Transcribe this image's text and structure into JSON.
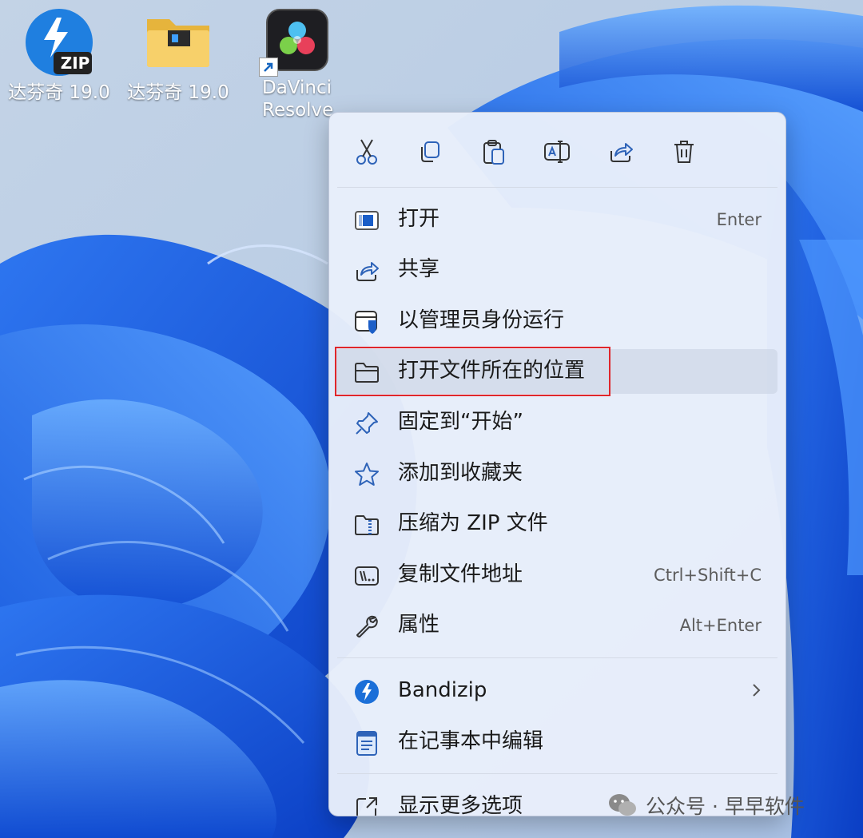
{
  "desktop": {
    "icons": [
      {
        "name": "bandizip-zip",
        "label": "达芬奇 19.0",
        "badge": "ZIP"
      },
      {
        "name": "folder",
        "label": "达芬奇 19.0"
      },
      {
        "name": "davinci-resolve",
        "label": "DaVinci\nResolve"
      }
    ]
  },
  "menu": {
    "toolbar": [
      "cut",
      "copy",
      "paste",
      "rename",
      "share",
      "delete"
    ],
    "items": [
      {
        "label": "打开",
        "shortcut": "Enter",
        "icon": "open-icon"
      },
      {
        "label": "共享",
        "shortcut": "",
        "icon": "share-icon"
      },
      {
        "label": "以管理员身份运行",
        "shortcut": "",
        "icon": "run-as-admin-icon"
      },
      {
        "label": "打开文件所在的位置",
        "shortcut": "",
        "icon": "folder-open-icon"
      },
      {
        "label": "固定到“开始”",
        "shortcut": "",
        "icon": "pin-icon"
      },
      {
        "label": "添加到收藏夹",
        "shortcut": "",
        "icon": "star-icon"
      },
      {
        "label": "压缩为 ZIP 文件",
        "shortcut": "",
        "icon": "zip-folder-icon"
      },
      {
        "label": "复制文件地址",
        "shortcut": "Ctrl+Shift+C",
        "icon": "copy-path-icon"
      },
      {
        "label": "属性",
        "shortcut": "Alt+Enter",
        "icon": "wrench-icon"
      },
      {
        "label": "Bandizip",
        "shortcut": "",
        "icon": "bandizip-icon",
        "submenu": true
      },
      {
        "label": "在记事本中编辑",
        "shortcut": "",
        "icon": "notepad-icon"
      },
      {
        "label": "显示更多选项",
        "shortcut": "",
        "icon": "more-options-icon"
      }
    ]
  },
  "watermark": {
    "text": "公众号 · 早早软件"
  },
  "colors": {
    "accent": "#0067c0",
    "highlight": "#e0262b"
  }
}
